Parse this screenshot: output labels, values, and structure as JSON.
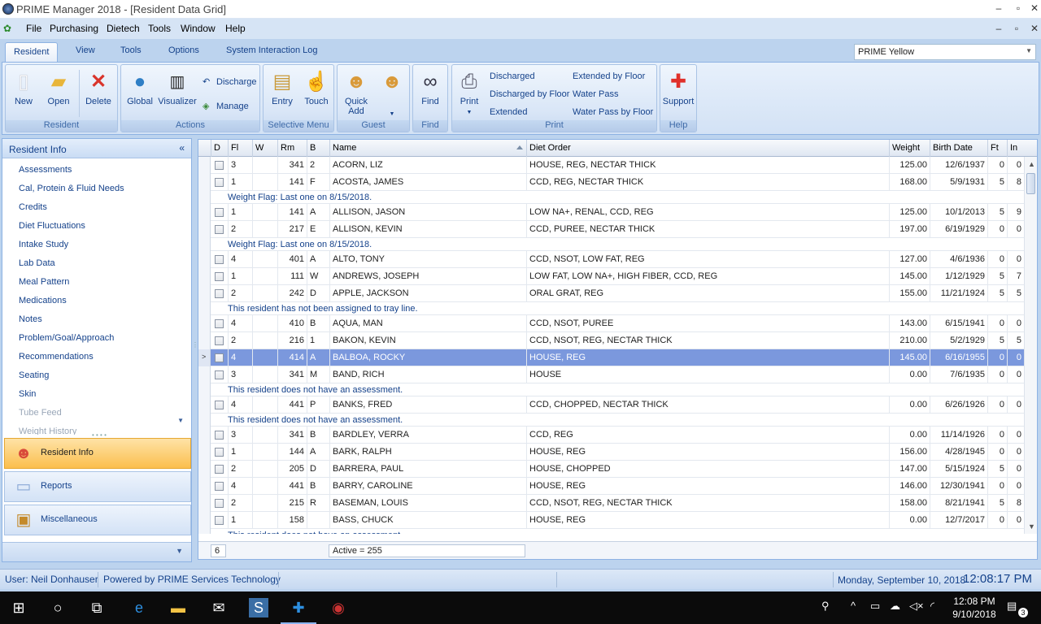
{
  "window": {
    "title": "PRIME Manager 2018 - [Resident Data Grid]"
  },
  "menu": [
    "File",
    "Purchasing",
    "Dietech",
    "Tools",
    "Window",
    "Help"
  ],
  "ribbon_tabs": [
    "Resident",
    "View",
    "Tools",
    "Options",
    "System Interaction Log"
  ],
  "skin": "PRIME Yellow",
  "groups": {
    "resident": {
      "label": "Resident",
      "new": "New",
      "open": "Open",
      "delete": "Delete"
    },
    "actions": {
      "label": "Actions",
      "global": "Global",
      "visualizer": "Visualizer",
      "discharge": "Discharge",
      "manage": "Manage"
    },
    "selective": {
      "label": "Selective Menu",
      "entry": "Entry",
      "touch": "Touch"
    },
    "guest": {
      "label": "Guest",
      "quick_add_1": "Quick",
      "quick_add_2": "Add"
    },
    "find": {
      "label": "Find",
      "find": "Find"
    },
    "print": {
      "label": "Print",
      "print": "Print",
      "discharged": "Discharged",
      "discharged_by_floor": "Discharged by Floor",
      "extended": "Extended",
      "extended_by_floor": "Extended by Floor",
      "water_pass": "Water Pass",
      "water_pass_by_floor": "Water Pass by Floor"
    },
    "help": {
      "label": "Help",
      "support": "Support"
    }
  },
  "nav": {
    "header": "Resident Info",
    "items": [
      "Assessments",
      "Cal, Protein & Fluid Needs",
      "Credits",
      "Diet Fluctuations",
      "Intake Study",
      "Lab Data",
      "Meal Pattern",
      "Medications",
      "Notes",
      "Problem/Goal/Approach",
      "Recommendations",
      "Seating",
      "Skin",
      "Tube Feed",
      "Weight History"
    ],
    "sections": [
      "Resident Info",
      "Reports",
      "Miscellaneous"
    ]
  },
  "grid": {
    "columns": [
      "D",
      "Fl",
      "W",
      "Rm",
      "B",
      "Name",
      "Diet Order",
      "Weight",
      "Birth Date",
      "Ft",
      "In"
    ],
    "rows": [
      {
        "fl": "3",
        "w": "",
        "rm": "341",
        "b": "2",
        "name": "ACORN, LIZ",
        "diet": "HOUSE, REG, NECTAR THICK",
        "weight": "125.00",
        "birth": "12/6/1937",
        "ft": "0",
        "in": "0"
      },
      {
        "fl": "1",
        "w": "",
        "rm": "141",
        "b": "F",
        "name": "ACOSTA, JAMES",
        "diet": "CCD, REG, NECTAR THICK",
        "weight": "168.00",
        "birth": "5/9/1931",
        "ft": "5",
        "in": "8",
        "note": "Weight Flag: Last one on 8/15/2018."
      },
      {
        "fl": "1",
        "w": "",
        "rm": "141",
        "b": "A",
        "name": "ALLISON, JASON",
        "diet": "LOW NA+, RENAL, CCD, REG",
        "weight": "125.00",
        "birth": "10/1/2013",
        "ft": "5",
        "in": "9"
      },
      {
        "fl": "2",
        "w": "",
        "rm": "217",
        "b": "E",
        "name": "ALLISON, KEVIN",
        "diet": "CCD, PUREE, NECTAR THICK",
        "weight": "197.00",
        "birth": "6/19/1929",
        "ft": "0",
        "in": "0",
        "note": "Weight Flag: Last one on 8/15/2018."
      },
      {
        "fl": "4",
        "w": "",
        "rm": "401",
        "b": "A",
        "name": "ALTO, TONY",
        "diet": "CCD, NSOT, LOW FAT, REG",
        "weight": "127.00",
        "birth": "4/6/1936",
        "ft": "0",
        "in": "0"
      },
      {
        "fl": "1",
        "w": "",
        "rm": "111",
        "b": "W",
        "name": "ANDREWS, JOSEPH",
        "diet": "LOW FAT, LOW NA+, HIGH FIBER, CCD, REG",
        "weight": "145.00",
        "birth": "1/12/1929",
        "ft": "5",
        "in": "7"
      },
      {
        "fl": "2",
        "w": "",
        "rm": "242",
        "b": "D",
        "name": "APPLE, JACKSON",
        "diet": "ORAL GRAT, REG",
        "weight": "155.00",
        "birth": "11/21/1924",
        "ft": "5",
        "in": "5",
        "note": "This resident has not been assigned to tray line."
      },
      {
        "fl": "4",
        "w": "",
        "rm": "410",
        "b": "B",
        "name": "AQUA, MAN",
        "diet": "CCD, NSOT, PUREE",
        "weight": "143.00",
        "birth": "6/15/1941",
        "ft": "0",
        "in": "0"
      },
      {
        "fl": "2",
        "w": "",
        "rm": "216",
        "b": "1",
        "name": "BAKON, KEVIN",
        "diet": "CCD, NSOT, REG, NECTAR THICK",
        "weight": "210.00",
        "birth": "5/2/1929",
        "ft": "5",
        "in": "5"
      },
      {
        "fl": "4",
        "w": "",
        "rm": "414",
        "b": "A",
        "name": "BALBOA, ROCKY",
        "diet": "HOUSE, REG",
        "weight": "145.00",
        "birth": "6/16/1955",
        "ft": "0",
        "in": "0",
        "selected": true
      },
      {
        "fl": "3",
        "w": "",
        "rm": "341",
        "b": "M",
        "name": "BAND, RICH",
        "diet": "HOUSE",
        "weight": "0.00",
        "birth": "7/6/1935",
        "ft": "0",
        "in": "0",
        "note": "This resident does not have an assessment."
      },
      {
        "fl": "4",
        "w": "",
        "rm": "441",
        "b": "P",
        "name": "BANKS, FRED",
        "diet": "CCD, CHOPPED, NECTAR THICK",
        "weight": "0.00",
        "birth": "6/26/1926",
        "ft": "0",
        "in": "0",
        "note": "This resident does not have an assessment."
      },
      {
        "fl": "3",
        "w": "",
        "rm": "341",
        "b": "B",
        "name": "BARDLEY, VERRA",
        "diet": "CCD, REG",
        "weight": "0.00",
        "birth": "11/14/1926",
        "ft": "0",
        "in": "0"
      },
      {
        "fl": "1",
        "w": "",
        "rm": "144",
        "b": "A",
        "name": "BARK, RALPH",
        "diet": "HOUSE, REG",
        "weight": "156.00",
        "birth": "4/28/1945",
        "ft": "0",
        "in": "0"
      },
      {
        "fl": "2",
        "w": "",
        "rm": "205",
        "b": "D",
        "name": "BARRERA, PAUL",
        "diet": "HOUSE, CHOPPED",
        "weight": "147.00",
        "birth": "5/15/1924",
        "ft": "5",
        "in": "0"
      },
      {
        "fl": "4",
        "w": "",
        "rm": "441",
        "b": "B",
        "name": "BARRY, CAROLINE",
        "diet": "HOUSE, REG",
        "weight": "146.00",
        "birth": "12/30/1941",
        "ft": "0",
        "in": "0"
      },
      {
        "fl": "2",
        "w": "",
        "rm": "215",
        "b": "R",
        "name": "BASEMAN, LOUIS",
        "diet": "CCD, NSOT, REG, NECTAR THICK",
        "weight": "158.00",
        "birth": "8/21/1941",
        "ft": "5",
        "in": "8"
      },
      {
        "fl": "1",
        "w": "",
        "rm": "158",
        "b": "",
        "name": "BASS, CHUCK",
        "diet": "HOUSE, REG",
        "weight": "0.00",
        "birth": "12/7/2017",
        "ft": "0",
        "in": "0",
        "note": "This resident does not have an assessment."
      }
    ],
    "footer": {
      "count": "6",
      "active": "Active = 255"
    }
  },
  "status": {
    "user": "User: Neil Donhauser",
    "powered": "Powered by PRIME Services Technology",
    "date": "Monday, September 10, 2018",
    "time": "12:08:17 PM"
  },
  "taskbar": {
    "time": "12:08 PM",
    "date": "9/10/2018",
    "notif": "3"
  },
  "colors": {
    "selected_row": "#7b98dd",
    "accent": "#15428b",
    "active_nav": "#fbbf4e"
  }
}
